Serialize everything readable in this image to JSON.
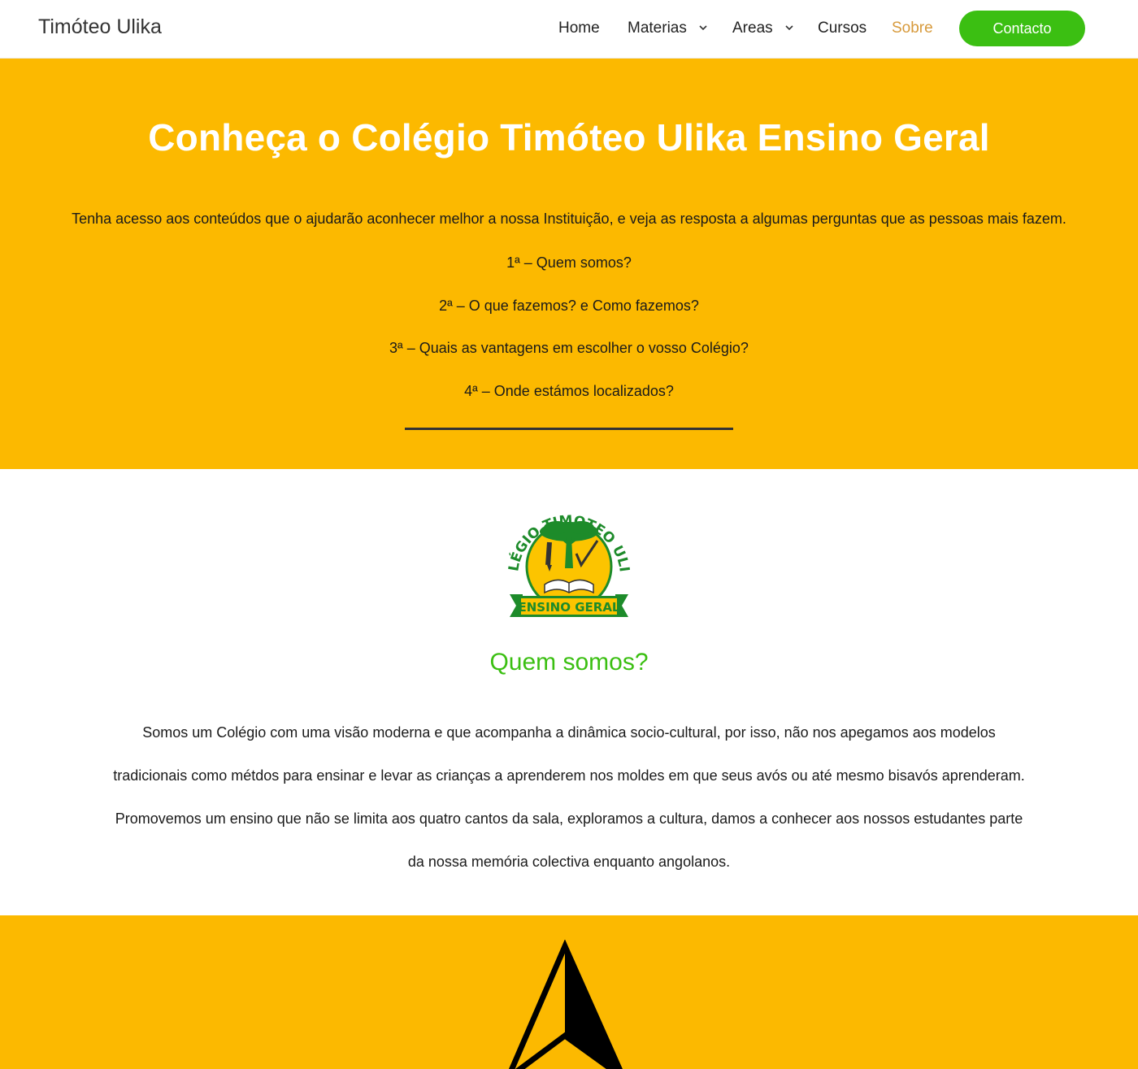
{
  "header": {
    "brand": "Timóteo Ulika",
    "nav": [
      {
        "label": "Home"
      },
      {
        "label": "Materias"
      },
      {
        "label": "Areas"
      },
      {
        "label": "Cursos"
      },
      {
        "label": "Sobre"
      }
    ],
    "contact_label": "Contacto"
  },
  "hero": {
    "title": "Conheça o Colégio Timóteo Ulika Ensino Geral",
    "intro": "Tenha acesso aos conteúdos que o ajudarão aconhecer melhor a nossa Instituição, e veja as resposta a algumas perguntas que as pessoas mais fazem.",
    "questions": [
      "1ª – Quem somos?",
      "2ª – O que fazemos? e Como fazemos?",
      "3ª – Quais as vantagens em escolher o vosso Colégio?",
      "4ª – Onde estámos localizados?"
    ]
  },
  "about": {
    "logo": {
      "arc_text": "COLÉGIO TIMOTEO ULIKA",
      "ribbon_text": "ENSINO GERAL"
    },
    "title": "Quem somos?",
    "lines": [
      "Somos um Colégio com uma visão moderna e que acompanha a dinâmica socio-cultural, por isso, não nos apegamos aos modelos",
      "tradicionais como métdos para ensinar e levar as crianças a aprenderem nos moldes em que seus avós ou até mesmo bisavós aprenderam.",
      "Promovemos um ensino que não se limita aos quatro cantos da sala, exploramos a cultura, damos a conhecer aos nossos estudantes parte",
      "da nossa memória colectiva enquanto angolanos."
    ]
  },
  "colors": {
    "accent_yellow": "#fcb900",
    "green": "#3bbf12",
    "active_nav": "#d79a3c"
  },
  "icons": [
    "chevron-down-icon",
    "navigation-arrow-icon"
  ]
}
